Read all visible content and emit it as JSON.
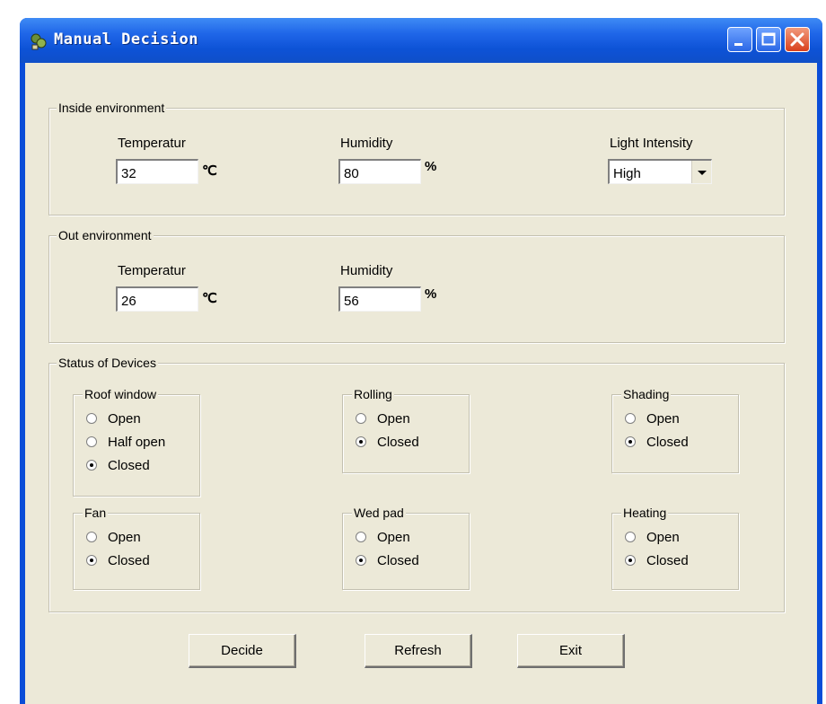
{
  "window": {
    "title": "Manual Decision",
    "minimize_label": "minimize",
    "maximize_label": "maximize",
    "close_label": "close"
  },
  "inside": {
    "legend": "Inside environment",
    "temp_label": "Temperatur",
    "temp_value": "32",
    "temp_unit": "℃",
    "hum_label": "Humidity",
    "hum_value": "80",
    "hum_unit": "%",
    "light_label": "Light Intensity",
    "light_value": "High"
  },
  "outside": {
    "legend": "Out environment",
    "temp_label": "Temperatur",
    "temp_value": "26",
    "temp_unit": "℃",
    "hum_label": "Humidity",
    "hum_value": "56",
    "hum_unit": "%"
  },
  "devices": {
    "legend": "Status of Devices",
    "roof": {
      "title": "Roof window",
      "options": [
        "Open",
        "Half open",
        "Closed"
      ],
      "selected": "Closed"
    },
    "rolling": {
      "title": "Rolling",
      "options": [
        "Open",
        "Closed"
      ],
      "selected": "Closed"
    },
    "shading": {
      "title": "Shading",
      "options": [
        "Open",
        "Closed"
      ],
      "selected": "Closed"
    },
    "fan": {
      "title": "Fan",
      "options": [
        "Open",
        "Closed"
      ],
      "selected": "Closed"
    },
    "wetpad": {
      "title": "Wed pad",
      "options": [
        "Open",
        "Closed"
      ],
      "selected": "Closed"
    },
    "heating": {
      "title": "Heating",
      "options": [
        "Open",
        "Closed"
      ],
      "selected": "Closed"
    }
  },
  "buttons": {
    "decide": "Decide",
    "refresh": "Refresh",
    "exit": "Exit"
  },
  "colors": {
    "titlebar": "#1f66e8",
    "client_bg": "#ece9d8",
    "close_btn": "#d9401c"
  }
}
